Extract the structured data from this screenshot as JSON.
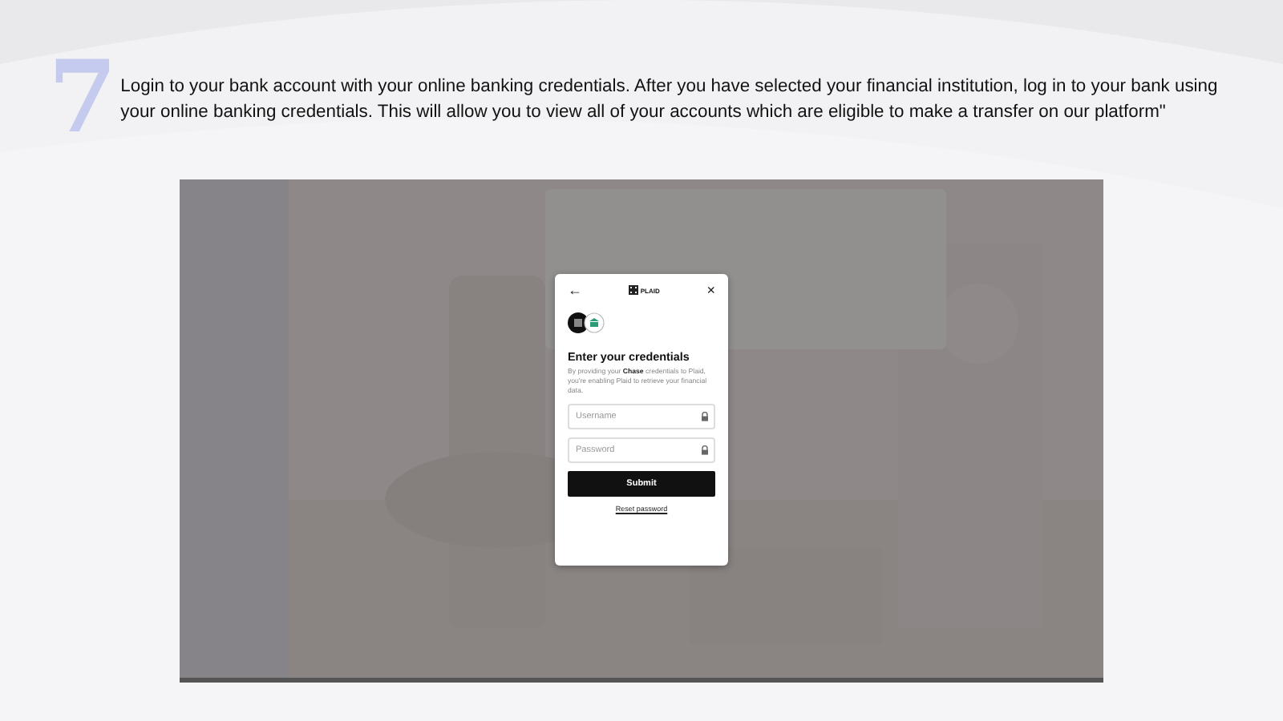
{
  "slide": {
    "step_number": "7",
    "text": "Login to your bank account with your online banking credentials. After you have selected your financial institution, log in to your bank using your online banking credentials.  This will allow you to view all of your accounts which are eligible to make a transfer on our platform\""
  },
  "screenshot": {
    "modal": {
      "back_icon": "←",
      "logo_text": "PLAID",
      "close_icon": "×",
      "title": "Enter your credentials",
      "description": "By providing your **Chase** credentials to Plaid, you're enabling Plaid to retrieve your financial data.",
      "fields": [
        {
          "placeholder": "Username"
        },
        {
          "placeholder": "Password"
        }
      ],
      "submit": "Submit",
      "link": "Reset password"
    }
  }
}
